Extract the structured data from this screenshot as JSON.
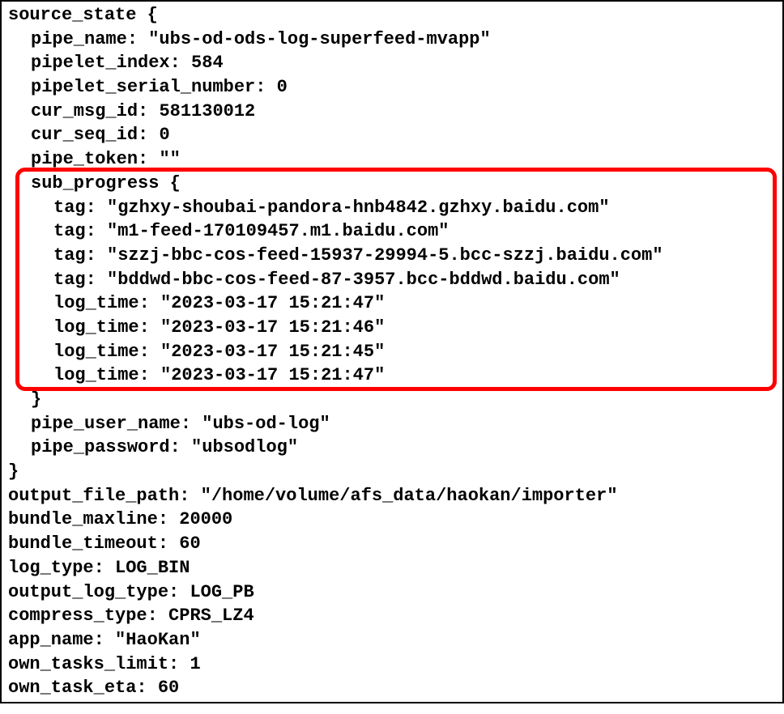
{
  "source_state": {
    "open": "source_state {",
    "pipe_name": {
      "key": "pipe_name:",
      "value": "\"ubs-od-ods-log-superfeed-mvapp\""
    },
    "pipelet_index": {
      "key": "pipelet_index:",
      "value": "584"
    },
    "pipelet_serial_number": {
      "key": "pipelet_serial_number:",
      "value": "0"
    },
    "cur_msg_id": {
      "key": "cur_msg_id:",
      "value": "581130012"
    },
    "cur_seq_id": {
      "key": "cur_seq_id:",
      "value": "0"
    },
    "pipe_token": {
      "key": "pipe_token:",
      "value": "\"\""
    },
    "sub_progress": {
      "open": "sub_progress {",
      "tags": [
        {
          "key": "tag:",
          "value": "\"gzhxy-shoubai-pandora-hnb4842.gzhxy.baidu.com\""
        },
        {
          "key": "tag:",
          "value": "\"m1-feed-170109457.m1.baidu.com\""
        },
        {
          "key": "tag:",
          "value": "\"szzj-bbc-cos-feed-15937-29994-5.bcc-szzj.baidu.com\""
        },
        {
          "key": "tag:",
          "value": "\"bddwd-bbc-cos-feed-87-3957.bcc-bddwd.baidu.com\""
        }
      ],
      "log_times": [
        {
          "key": "log_time:",
          "value": "\"2023-03-17 15:21:47\""
        },
        {
          "key": "log_time:",
          "value": "\"2023-03-17 15:21:46\""
        },
        {
          "key": "log_time:",
          "value": "\"2023-03-17 15:21:45\""
        },
        {
          "key": "log_time:",
          "value": "\"2023-03-17 15:21:47\""
        }
      ],
      "close": "}"
    },
    "pipe_user_name": {
      "key": "pipe_user_name:",
      "value": "\"ubs-od-log\""
    },
    "pipe_password": {
      "key": "pipe_password:",
      "value": "\"ubsodlog\""
    },
    "close": "}"
  },
  "output_file_path": {
    "key": "output_file_path:",
    "value": "\"/home/volume/afs_data/haokan/importer\""
  },
  "bundle_maxline": {
    "key": "bundle_maxline:",
    "value": "20000"
  },
  "bundle_timeout": {
    "key": "bundle_timeout:",
    "value": "60"
  },
  "log_type": {
    "key": "log_type:",
    "value": "LOG_BIN"
  },
  "output_log_type": {
    "key": "output_log_type:",
    "value": "LOG_PB"
  },
  "compress_type": {
    "key": "compress_type:",
    "value": "CPRS_LZ4"
  },
  "app_name": {
    "key": "app_name:",
    "value": "\"HaoKan\""
  },
  "own_tasks_limit": {
    "key": "own_tasks_limit:",
    "value": "1"
  },
  "own_task_eta": {
    "key": "own_task_eta:",
    "value": "60"
  }
}
